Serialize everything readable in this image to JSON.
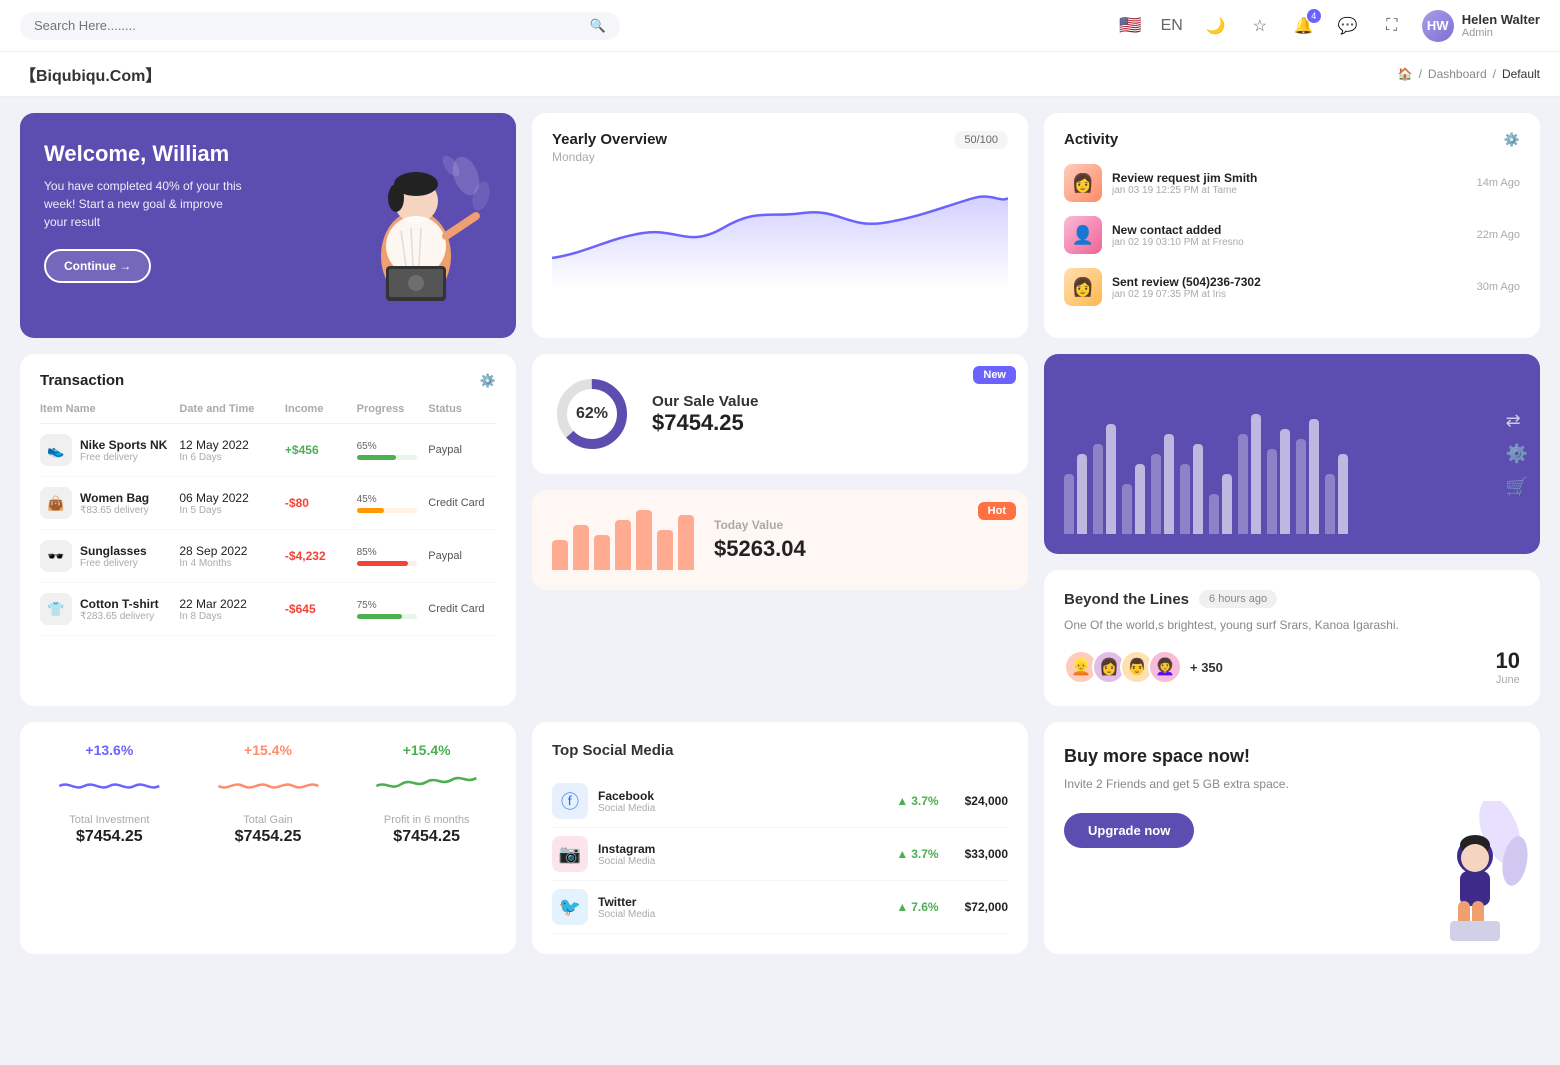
{
  "topnav": {
    "search_placeholder": "Search Here........",
    "language": "EN",
    "notification_count": "4",
    "user_name": "Helen Walter",
    "user_role": "Admin"
  },
  "breadcrumb": {
    "brand": "【Biqubiqu.Com】",
    "home": "Home",
    "dashboard": "Dashboard",
    "current": "Default"
  },
  "welcome": {
    "title": "Welcome, William",
    "description": "You have completed 40% of your this week! Start a new goal & improve your result",
    "button": "Continue →"
  },
  "yearly_overview": {
    "title": "Yearly Overview",
    "subtitle": "Monday",
    "badge": "50/100"
  },
  "activity": {
    "title": "Activity",
    "items": [
      {
        "name": "Review request jim Smith",
        "detail": "jan 03 19 12:25 PM at Tame",
        "time": "14m Ago"
      },
      {
        "name": "New contact added",
        "detail": "jan 02 19 03:10 PM at Fresno",
        "time": "22m Ago"
      },
      {
        "name": "Sent review (504)236-7302",
        "detail": "jan 02 19 07:35 PM at Iris",
        "time": "30m Ago"
      }
    ]
  },
  "transaction": {
    "title": "Transaction",
    "headers": [
      "Item Name",
      "Date and Time",
      "Income",
      "Progress",
      "Status"
    ],
    "rows": [
      {
        "icon": "👟",
        "name": "Nike Sports NK",
        "sub": "Free delivery",
        "date": "12 May 2022",
        "date_sub": "In 6 Days",
        "income": "+$456",
        "income_type": "positive",
        "progress": 65,
        "progress_color": "#4caf50",
        "status": "Paypal"
      },
      {
        "icon": "👜",
        "name": "Women Bag",
        "sub": "₹83.65 delivery",
        "date": "06 May 2022",
        "date_sub": "In 5 Days",
        "income": "-$80",
        "income_type": "negative",
        "progress": 45,
        "progress_color": "#ff9800",
        "status": "Credit Card"
      },
      {
        "icon": "🕶️",
        "name": "Sunglasses",
        "sub": "Free delivery",
        "date": "28 Sep 2022",
        "date_sub": "In 4 Months",
        "income": "-$4,232",
        "income_type": "negative",
        "progress": 85,
        "progress_color": "#f44336",
        "status": "Paypal"
      },
      {
        "icon": "👕",
        "name": "Cotton T-shirt",
        "sub": "₹283.65 delivery",
        "date": "22 Mar 2022",
        "date_sub": "In 8 Days",
        "income": "-$645",
        "income_type": "negative",
        "progress": 75,
        "progress_color": "#4caf50",
        "status": "Credit Card"
      }
    ]
  },
  "sale_value": {
    "badge": "New",
    "percent": "62%",
    "label": "Our Sale Value",
    "value": "$7454.25"
  },
  "today_value": {
    "badge": "Hot",
    "label": "Today Value",
    "value": "$5263.04",
    "bars": [
      30,
      45,
      35,
      50,
      60,
      40,
      55
    ]
  },
  "bar_chart": {
    "bars": [
      {
        "light": 60,
        "dark": 80
      },
      {
        "light": 90,
        "dark": 110
      },
      {
        "light": 50,
        "dark": 70
      },
      {
        "light": 80,
        "dark": 100
      },
      {
        "light": 70,
        "dark": 90
      },
      {
        "light": 40,
        "dark": 60
      },
      {
        "light": 100,
        "dark": 120
      },
      {
        "light": 85,
        "dark": 105
      },
      {
        "light": 95,
        "dark": 115
      },
      {
        "light": 60,
        "dark": 80
      }
    ]
  },
  "beyond": {
    "title": "Beyond the Lines",
    "time": "6 hours ago",
    "description": "One Of the world,s brightest, young surf Srars, Kanoa Igarashi.",
    "plus_count": "+ 350",
    "date_num": "10",
    "date_month": "June",
    "participants": [
      "👱",
      "👩",
      "👨",
      "👩‍🦱"
    ]
  },
  "stats": [
    {
      "percent": "+13.6%",
      "color": "purple",
      "label": "Total Investment",
      "value": "$7454.25"
    },
    {
      "percent": "+15.4%",
      "color": "orange",
      "label": "Total Gain",
      "value": "$7454.25"
    },
    {
      "percent": "+15.4%",
      "color": "green",
      "label": "Profit in 6 months",
      "value": "$7454.25"
    }
  ],
  "social_media": {
    "title": "Top Social Media",
    "items": [
      {
        "icon": "📘",
        "name": "Facebook",
        "type": "Social Media",
        "growth": "3.7%",
        "amount": "$24,000",
        "color": "#1877f2"
      },
      {
        "icon": "📷",
        "name": "Instagram",
        "type": "Social Media",
        "growth": "3.7%",
        "amount": "$33,000",
        "color": "#e1306c"
      },
      {
        "icon": "🐦",
        "name": "Twitter",
        "type": "Social Media",
        "growth": "7.6%",
        "amount": "$72,000",
        "color": "#1da1f2"
      }
    ]
  },
  "buy_space": {
    "title": "Buy more space now!",
    "description": "Invite 2 Friends and get 5 GB extra space.",
    "button": "Upgrade now"
  }
}
